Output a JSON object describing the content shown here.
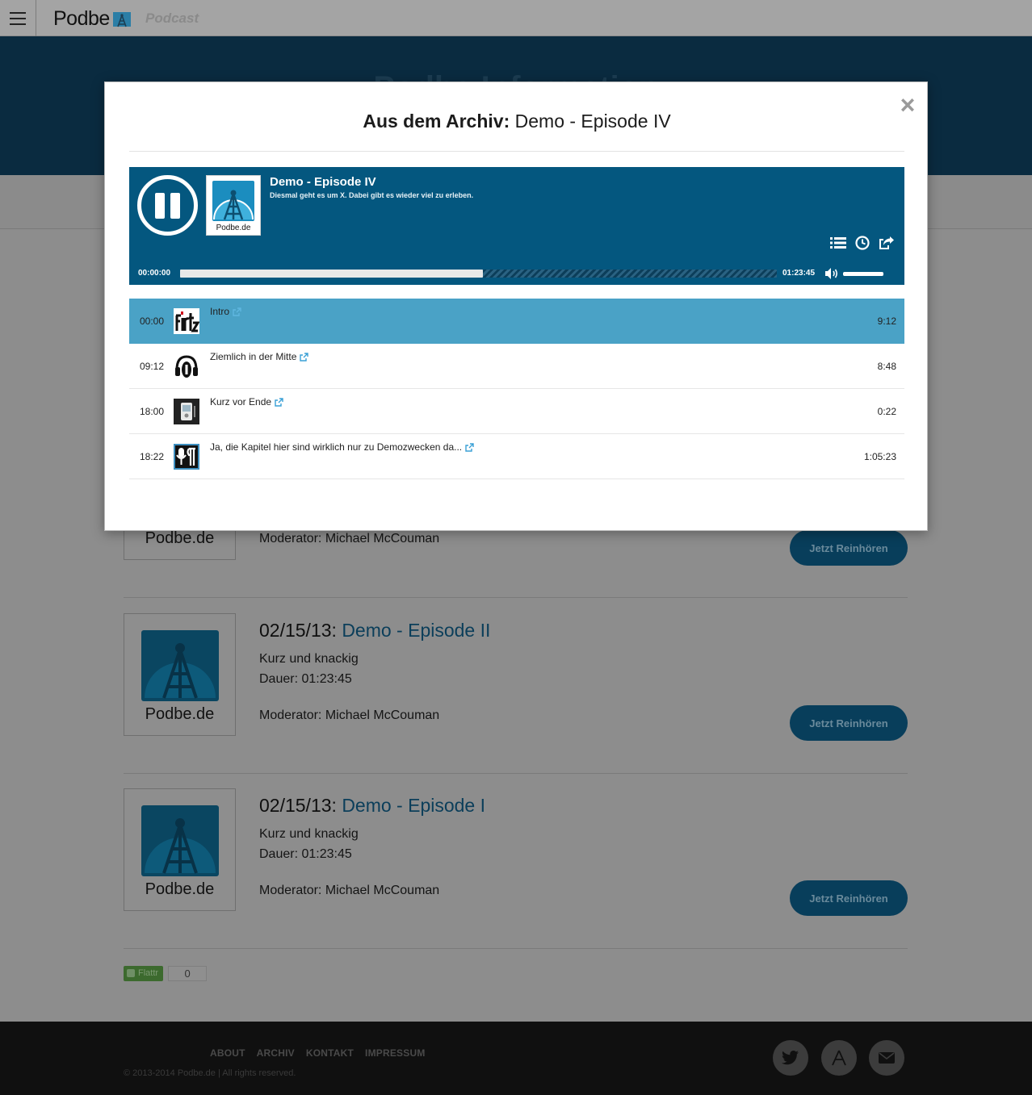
{
  "brand": {
    "name": "Podbe",
    "tagline": "Podcast"
  },
  "hero": {
    "title": "Podbe Information"
  },
  "episodes": [
    {
      "date": "",
      "title": "",
      "subtitle": "",
      "duration": "",
      "moderator": "Moderator: Michael McCouman",
      "button": "Jetzt Reinhören",
      "cover_label": "Podbe.de"
    },
    {
      "date": "02/15/13:",
      "title": "Demo - Episode II",
      "subtitle": "Kurz und knackig",
      "duration": "Dauer: 01:23:45",
      "moderator": "Moderator: Michael McCouman",
      "button": "Jetzt Reinhören",
      "cover_label": "Podbe.de"
    },
    {
      "date": "02/15/13:",
      "title": "Demo - Episode I",
      "subtitle": "Kurz und knackig",
      "duration": "Dauer: 01:23:45",
      "moderator": "Moderator: Michael McCouman",
      "button": "Jetzt Reinhören",
      "cover_label": "Podbe.de"
    }
  ],
  "flattr": {
    "label": "Flattr",
    "count": "0"
  },
  "footer": {
    "nav": [
      "ABOUT",
      "ARCHIV",
      "KONTAKT",
      "IMPRESSUM"
    ],
    "copyright": "© 2013-2014 Podbe.de | All rights reserved.",
    "social_icons": [
      "twitter-icon",
      "app-store-icon",
      "mail-icon"
    ]
  },
  "modal": {
    "title_bold": "Aus dem Archiv:",
    "title_rest": " Demo - Episode IV",
    "close": "×"
  },
  "player": {
    "title": "Demo - Episode IV",
    "subtitle": "Diesmal geht es um X. Dabei gibt es wieder viel zu erleben.",
    "cover_label": "Podbe.de",
    "time_current": "00:00:00",
    "time_total": "01:23:45",
    "progress": 0.508,
    "volume": 1.0,
    "accent": "#04577f"
  },
  "chapters": [
    {
      "start": "00:00",
      "title": "Intro",
      "duration": "9:12",
      "active": true,
      "image": "fritz-logo"
    },
    {
      "start": "09:12",
      "title": "Ziemlich in der Mitte",
      "duration": "8:48",
      "active": false,
      "image": "headphones-logo"
    },
    {
      "start": "18:00",
      "title": "Kurz vor Ende",
      "duration": "0:22",
      "active": false,
      "image": "device-logo"
    },
    {
      "start": "18:22",
      "title": "Ja, die Kapitel hier sind wirklich nur zu Demozwecken da...",
      "duration": "1:05:23",
      "active": false,
      "image": "mic-logo"
    }
  ]
}
